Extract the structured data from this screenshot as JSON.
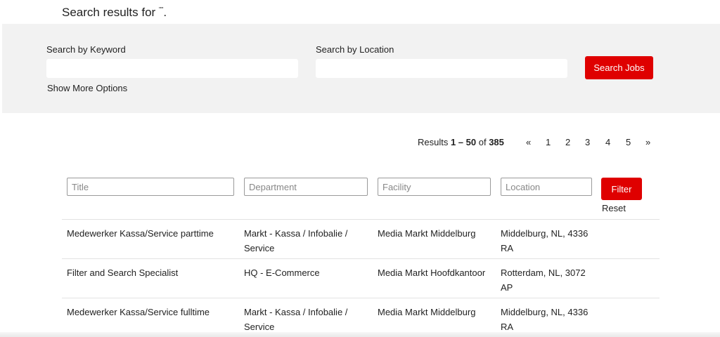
{
  "page": {
    "heading": "Search results for",
    "heading_quote": "\"\"",
    "heading_end": "."
  },
  "search": {
    "keyword_label": "Search by Keyword",
    "keyword_value": "",
    "location_label": "Search by Location",
    "location_value": "",
    "show_more_label": "Show More Options",
    "search_button_label": "Search Jobs"
  },
  "results": {
    "prefix": "Results ",
    "range": "1 – 50",
    "of": " of ",
    "total": "385"
  },
  "pagination": {
    "prev": "«",
    "pages": [
      "1",
      "2",
      "3",
      "4",
      "5"
    ],
    "next": "»"
  },
  "filters": {
    "title_placeholder": "Title",
    "department_placeholder": "Department",
    "facility_placeholder": "Facility",
    "location_placeholder": "Location",
    "filter_button_label": "Filter",
    "reset_label": "Reset"
  },
  "jobs": [
    {
      "title": "Medewerker Kassa/Service parttime",
      "department": "Markt - Kassa / Infobalie / Service",
      "facility": "Media Markt Middelburg",
      "location": "Middelburg, NL, 4336 RA"
    },
    {
      "title": "Filter and Search Specialist",
      "department": "HQ - E-Commerce",
      "facility": "Media Markt Hoofdkantoor",
      "location": "Rotterdam, NL, 3072 AP"
    },
    {
      "title": "Medewerker Kassa/Service fulltime",
      "department": "Markt - Kassa / Infobalie / Service",
      "facility": "Media Markt Middelburg",
      "location": "Middelburg, NL, 4336 RA"
    }
  ],
  "colors": {
    "accent": "#df0000",
    "panel_background": "#f2f2f2"
  }
}
